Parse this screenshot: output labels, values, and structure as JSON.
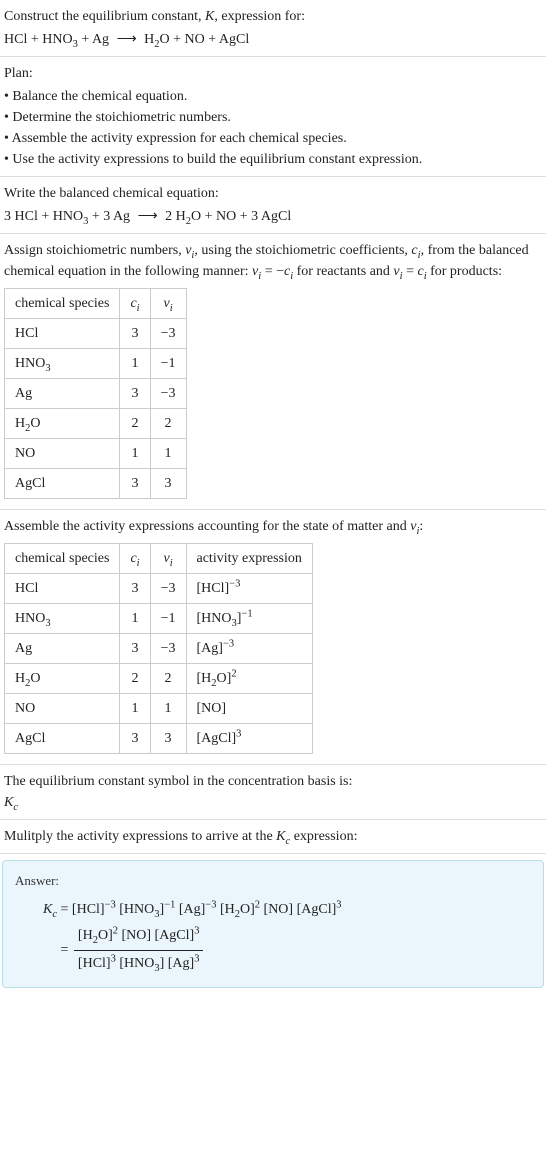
{
  "intro": {
    "line1_prefix": "Construct the equilibrium constant, ",
    "line1_k": "K",
    "line1_suffix": ", expression for:",
    "equation_lhs_1": "HCl + HNO",
    "equation_lhs_2": " + Ag",
    "equation_rhs_1": "H",
    "equation_rhs_2": "O + NO + AgCl"
  },
  "plan": {
    "heading": "Plan:",
    "items": [
      "• Balance the chemical equation.",
      "• Determine the stoichiometric numbers.",
      "• Assemble the activity expression for each chemical species.",
      "• Use the activity expressions to build the equilibrium constant expression."
    ]
  },
  "balanced": {
    "heading": "Write the balanced chemical equation:",
    "lhs_pre": "3 HCl + HNO",
    "lhs_post": " + 3 Ag",
    "rhs_pre": "2 H",
    "rhs_post": "O + NO + 3 AgCl"
  },
  "stoich_text": {
    "p1a": "Assign stoichiometric numbers, ",
    "nu_i": "ν",
    "p1b": ", using the stoichiometric coefficients, ",
    "c_i": "c",
    "p1c": ", from the balanced chemical equation in the following manner: ",
    "rel_react": " = −",
    "p1d": " for reactants and ",
    "rel_prod": " = ",
    "p1e": " for products:"
  },
  "table1": {
    "headers": {
      "species": "chemical species"
    },
    "rows": [
      {
        "sp": "HCl",
        "sub": "",
        "c": "3",
        "nu": "−3"
      },
      {
        "sp": "HNO",
        "sub": "3",
        "c": "1",
        "nu": "−1"
      },
      {
        "sp": "Ag",
        "sub": "",
        "c": "3",
        "nu": "−3"
      },
      {
        "sp": "H",
        "sub": "2",
        "post": "O",
        "c": "2",
        "nu": "2"
      },
      {
        "sp": "NO",
        "sub": "",
        "c": "1",
        "nu": "1"
      },
      {
        "sp": "AgCl",
        "sub": "",
        "c": "3",
        "nu": "3"
      }
    ]
  },
  "activity": {
    "heading_a": "Assemble the activity expressions accounting for the state of matter and ",
    "heading_b": ":"
  },
  "table2": {
    "headers": {
      "species": "chemical species",
      "act": "activity expression"
    },
    "rows": [
      {
        "sp": "HCl",
        "sub": "",
        "c": "3",
        "nu": "−3",
        "base": "[HCl]",
        "exp": "−3"
      },
      {
        "sp": "HNO",
        "sub": "3",
        "c": "1",
        "nu": "−1",
        "base": "[HNO",
        "bsub": "3",
        "bpost": "]",
        "exp": "−1"
      },
      {
        "sp": "Ag",
        "sub": "",
        "c": "3",
        "nu": "−3",
        "base": "[Ag]",
        "exp": "−3"
      },
      {
        "sp": "H",
        "sub": "2",
        "post": "O",
        "c": "2",
        "nu": "2",
        "base": "[H",
        "bsub": "2",
        "bpost": "O]",
        "exp": "2"
      },
      {
        "sp": "NO",
        "sub": "",
        "c": "1",
        "nu": "1",
        "base": "[NO]",
        "exp": ""
      },
      {
        "sp": "AgCl",
        "sub": "",
        "c": "3",
        "nu": "3",
        "base": "[AgCl]",
        "exp": "3"
      }
    ]
  },
  "basis": {
    "heading": "The equilibrium constant symbol in the concentration basis is:",
    "symbol": "K",
    "sub": "c"
  },
  "multiply": {
    "a": "Mulitply the activity expressions to arrive at the ",
    "kc": "K",
    "b": " expression:"
  },
  "answer": {
    "label": "Answer:",
    "line1": {
      "lhs": "K",
      "terms": [
        {
          "b": "[HCl]",
          "e": "−3"
        },
        {
          "b": "[HNO",
          "bsub": "3",
          "bpost": "]",
          "e": "−1"
        },
        {
          "b": "[Ag]",
          "e": "−3"
        },
        {
          "b": "[H",
          "bsub": "2",
          "bpost": "O]",
          "e": "2"
        },
        {
          "b": "[NO]"
        },
        {
          "b": "[AgCl]",
          "e": "3"
        }
      ]
    },
    "frac": {
      "num": [
        {
          "b": "[H",
          "bsub": "2",
          "bpost": "O]",
          "e": "2"
        },
        {
          "b": "[NO]"
        },
        {
          "b": "[AgCl]",
          "e": "3"
        }
      ],
      "den": [
        {
          "b": "[HCl]",
          "e": "3"
        },
        {
          "b": "[HNO",
          "bsub": "3",
          "bpost": "]"
        },
        {
          "b": "[Ag]",
          "e": "3"
        }
      ]
    }
  }
}
